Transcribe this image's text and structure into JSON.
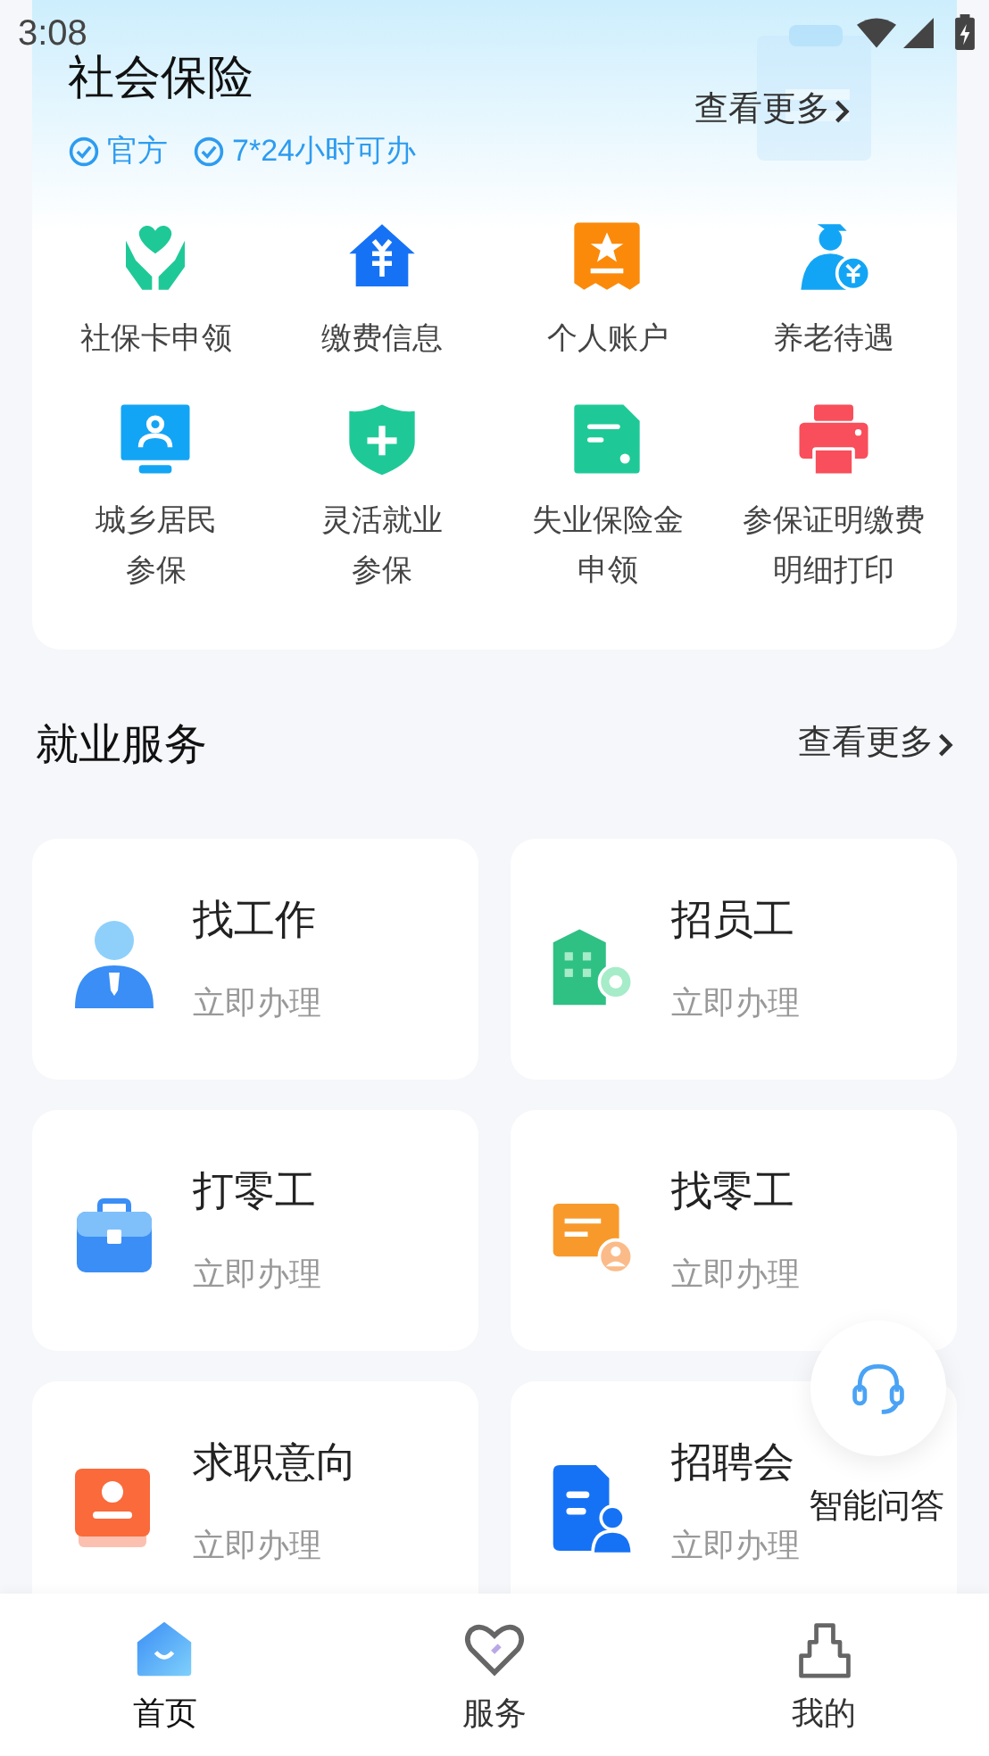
{
  "status_bar": {
    "time": "3:08"
  },
  "social_insurance": {
    "title": "社会保险",
    "more": "查看更多",
    "badges": [
      "官方",
      "7*24小时可办"
    ],
    "items": [
      {
        "lines": [
          "社保卡申领"
        ]
      },
      {
        "lines": [
          "缴费信息"
        ]
      },
      {
        "lines": [
          "个人账户"
        ]
      },
      {
        "lines": [
          "养老待遇"
        ]
      },
      {
        "lines": [
          "城乡居民",
          "参保"
        ]
      },
      {
        "lines": [
          "灵活就业",
          "参保"
        ]
      },
      {
        "lines": [
          "失业保险金",
          "申领"
        ]
      },
      {
        "lines": [
          "参保证明缴费",
          "明细打印"
        ]
      }
    ]
  },
  "employment": {
    "title": "就业服务",
    "more": "查看更多",
    "cards": [
      {
        "title": "找工作",
        "action": "立即办理"
      },
      {
        "title": "招员工",
        "action": "立即办理"
      },
      {
        "title": "打零工",
        "action": "立即办理"
      },
      {
        "title": "找零工",
        "action": "立即办理"
      },
      {
        "title": "求职意向",
        "action": "立即办理"
      },
      {
        "title": "招聘会",
        "action": "立即办理"
      }
    ]
  },
  "assistant": {
    "label": "智能问答"
  },
  "bottom_nav": [
    {
      "label": "首页",
      "selected": true
    },
    {
      "label": "服务",
      "selected": false
    },
    {
      "label": "我的",
      "selected": false
    }
  ]
}
